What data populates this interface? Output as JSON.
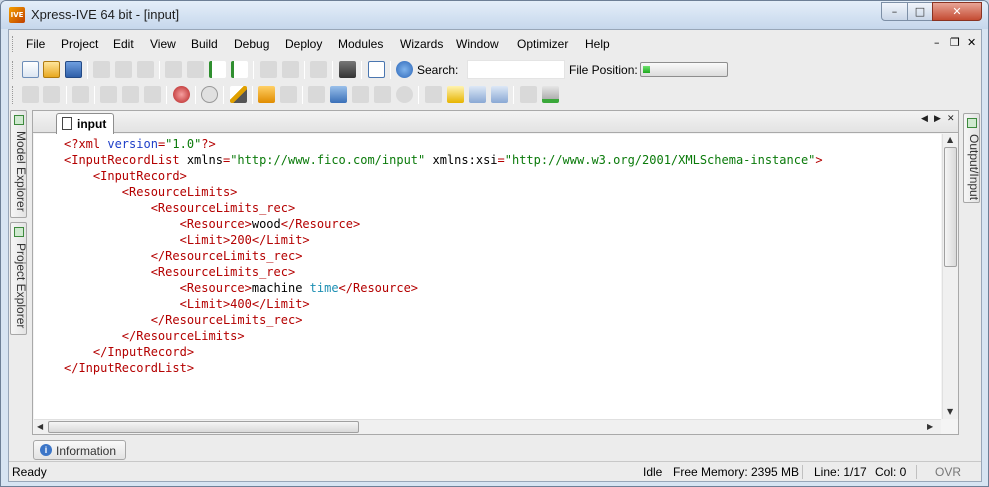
{
  "window": {
    "title": "Xpress-IVE 64 bit - [input]",
    "app_icon_text": "IVE",
    "buttons": {
      "minimize": "–",
      "maximize": "□",
      "close": "✕"
    }
  },
  "menu": {
    "items": [
      "File",
      "Project",
      "Edit",
      "View",
      "Build",
      "Debug",
      "Deploy",
      "Modules",
      "Wizards",
      "Window",
      "Optimizer",
      "Help"
    ],
    "mdi_controls": {
      "minimize": "–",
      "restore": "❐",
      "close": "✕"
    }
  },
  "toolbar": {
    "search_label": "Search:",
    "search_value": "",
    "file_position_label": "File Position:",
    "file_position_progress": 0.08
  },
  "side_panels": {
    "left": [
      "Model Explorer",
      "Project Explorer"
    ],
    "right": [
      "Output/Input"
    ]
  },
  "editor": {
    "tab_label": "input",
    "tab_nav": {
      "prev": "◀",
      "next": "▶",
      "close": "✕"
    },
    "lines": [
      {
        "indent": 0,
        "parts": [
          [
            "t",
            "<?xml "
          ],
          [
            "a",
            "version"
          ],
          [
            "t",
            "="
          ],
          [
            "s",
            "\"1.0\""
          ],
          [
            "t",
            "?>"
          ]
        ]
      },
      {
        "indent": 0,
        "parts": [
          [
            "t",
            "<InputRecordList "
          ],
          [
            "n",
            "xmlns"
          ],
          [
            "t",
            "="
          ],
          [
            "s",
            "\"http://www.fico.com/input\""
          ],
          [
            "n",
            " xmlns:xsi"
          ],
          [
            "t",
            "="
          ],
          [
            "s",
            "\"http://www.w3.org/2001/XMLSchema-instance\""
          ],
          [
            "t",
            ">"
          ]
        ]
      },
      {
        "indent": 1,
        "parts": [
          [
            "t",
            "<InputRecord>"
          ]
        ]
      },
      {
        "indent": 2,
        "parts": [
          [
            "t",
            "<ResourceLimits>"
          ]
        ]
      },
      {
        "indent": 3,
        "parts": [
          [
            "t",
            "<ResourceLimits_rec>"
          ]
        ]
      },
      {
        "indent": 4,
        "parts": [
          [
            "t",
            "<Resource>"
          ],
          [
            "n",
            "wood"
          ],
          [
            "t",
            "</Resource>"
          ]
        ]
      },
      {
        "indent": 4,
        "parts": [
          [
            "t",
            "<Limit>"
          ],
          [
            "t",
            "200"
          ],
          [
            "t",
            "</Limit>"
          ]
        ]
      },
      {
        "indent": 3,
        "parts": [
          [
            "t",
            "</ResourceLimits_rec>"
          ]
        ]
      },
      {
        "indent": 3,
        "parts": [
          [
            "t",
            "<ResourceLimits_rec>"
          ]
        ]
      },
      {
        "indent": 4,
        "parts": [
          [
            "t",
            "<Resource>"
          ],
          [
            "n",
            "machine "
          ],
          [
            "k",
            "time"
          ],
          [
            "t",
            "</Resource>"
          ]
        ]
      },
      {
        "indent": 4,
        "parts": [
          [
            "t",
            "<Limit>"
          ],
          [
            "t",
            "400"
          ],
          [
            "t",
            "</Limit>"
          ]
        ]
      },
      {
        "indent": 3,
        "parts": [
          [
            "t",
            "</ResourceLimits_rec>"
          ]
        ]
      },
      {
        "indent": 2,
        "parts": [
          [
            "t",
            "</ResourceLimits>"
          ]
        ]
      },
      {
        "indent": 1,
        "parts": [
          [
            "t",
            "</InputRecord>"
          ]
        ]
      },
      {
        "indent": 0,
        "parts": [
          [
            "t",
            "</InputRecordList>"
          ]
        ]
      }
    ]
  },
  "info_panel": {
    "label": "Information",
    "icon_text": "i"
  },
  "status": {
    "left": "Ready",
    "state": "Idle",
    "memory": "Free Memory: 2395 MB",
    "line": "Line: 1/17",
    "col": "Col: 0",
    "mode": "OVR"
  },
  "colors": {
    "tag": "#b40000",
    "attribute": "#1e3fc8",
    "string": "#0a7a0a",
    "keyword": "#1d8fb3",
    "progress": "#1ea81e"
  }
}
